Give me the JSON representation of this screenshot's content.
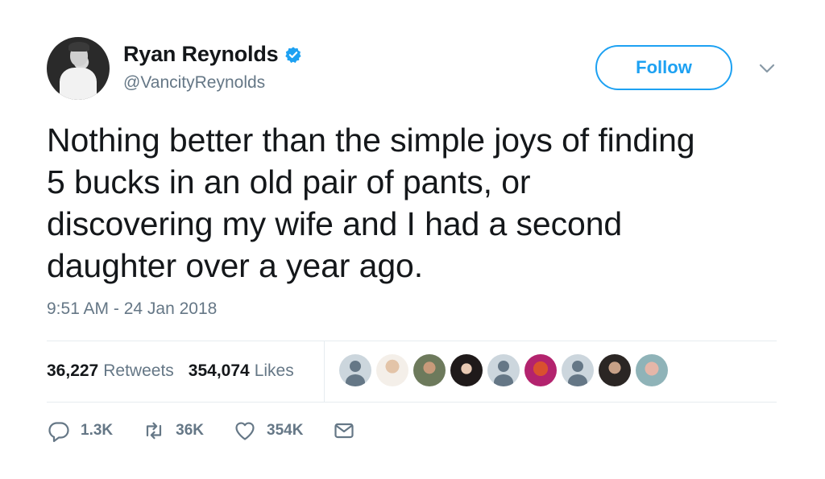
{
  "author": {
    "display_name": "Ryan Reynolds",
    "handle": "@VancityReynolds",
    "verified": true
  },
  "follow_button": {
    "label": "Follow"
  },
  "tweet": {
    "line1": "Nothing better than the simple joys of finding",
    "line2": "5 bucks in an old pair of pants, or",
    "line3": "discovering my wife and I had a second",
    "line4": "daughter over a year ago.",
    "timestamp": "9:51 AM - 24 Jan 2018"
  },
  "stats": {
    "retweets_count": "36,227",
    "retweets_label": "Retweets",
    "likes_count": "354,074",
    "likes_label": "Likes"
  },
  "actions": {
    "reply_count": "1.3K",
    "retweet_count": "36K",
    "like_count": "354K"
  },
  "icons": [
    "verified-icon",
    "chevron-down-icon",
    "reply-icon",
    "retweet-icon",
    "like-icon",
    "message-icon"
  ],
  "colors": {
    "accent": "#1da1f2",
    "secondary_text": "#657786",
    "primary_text": "#14171a",
    "divider": "#e6ecf0"
  }
}
